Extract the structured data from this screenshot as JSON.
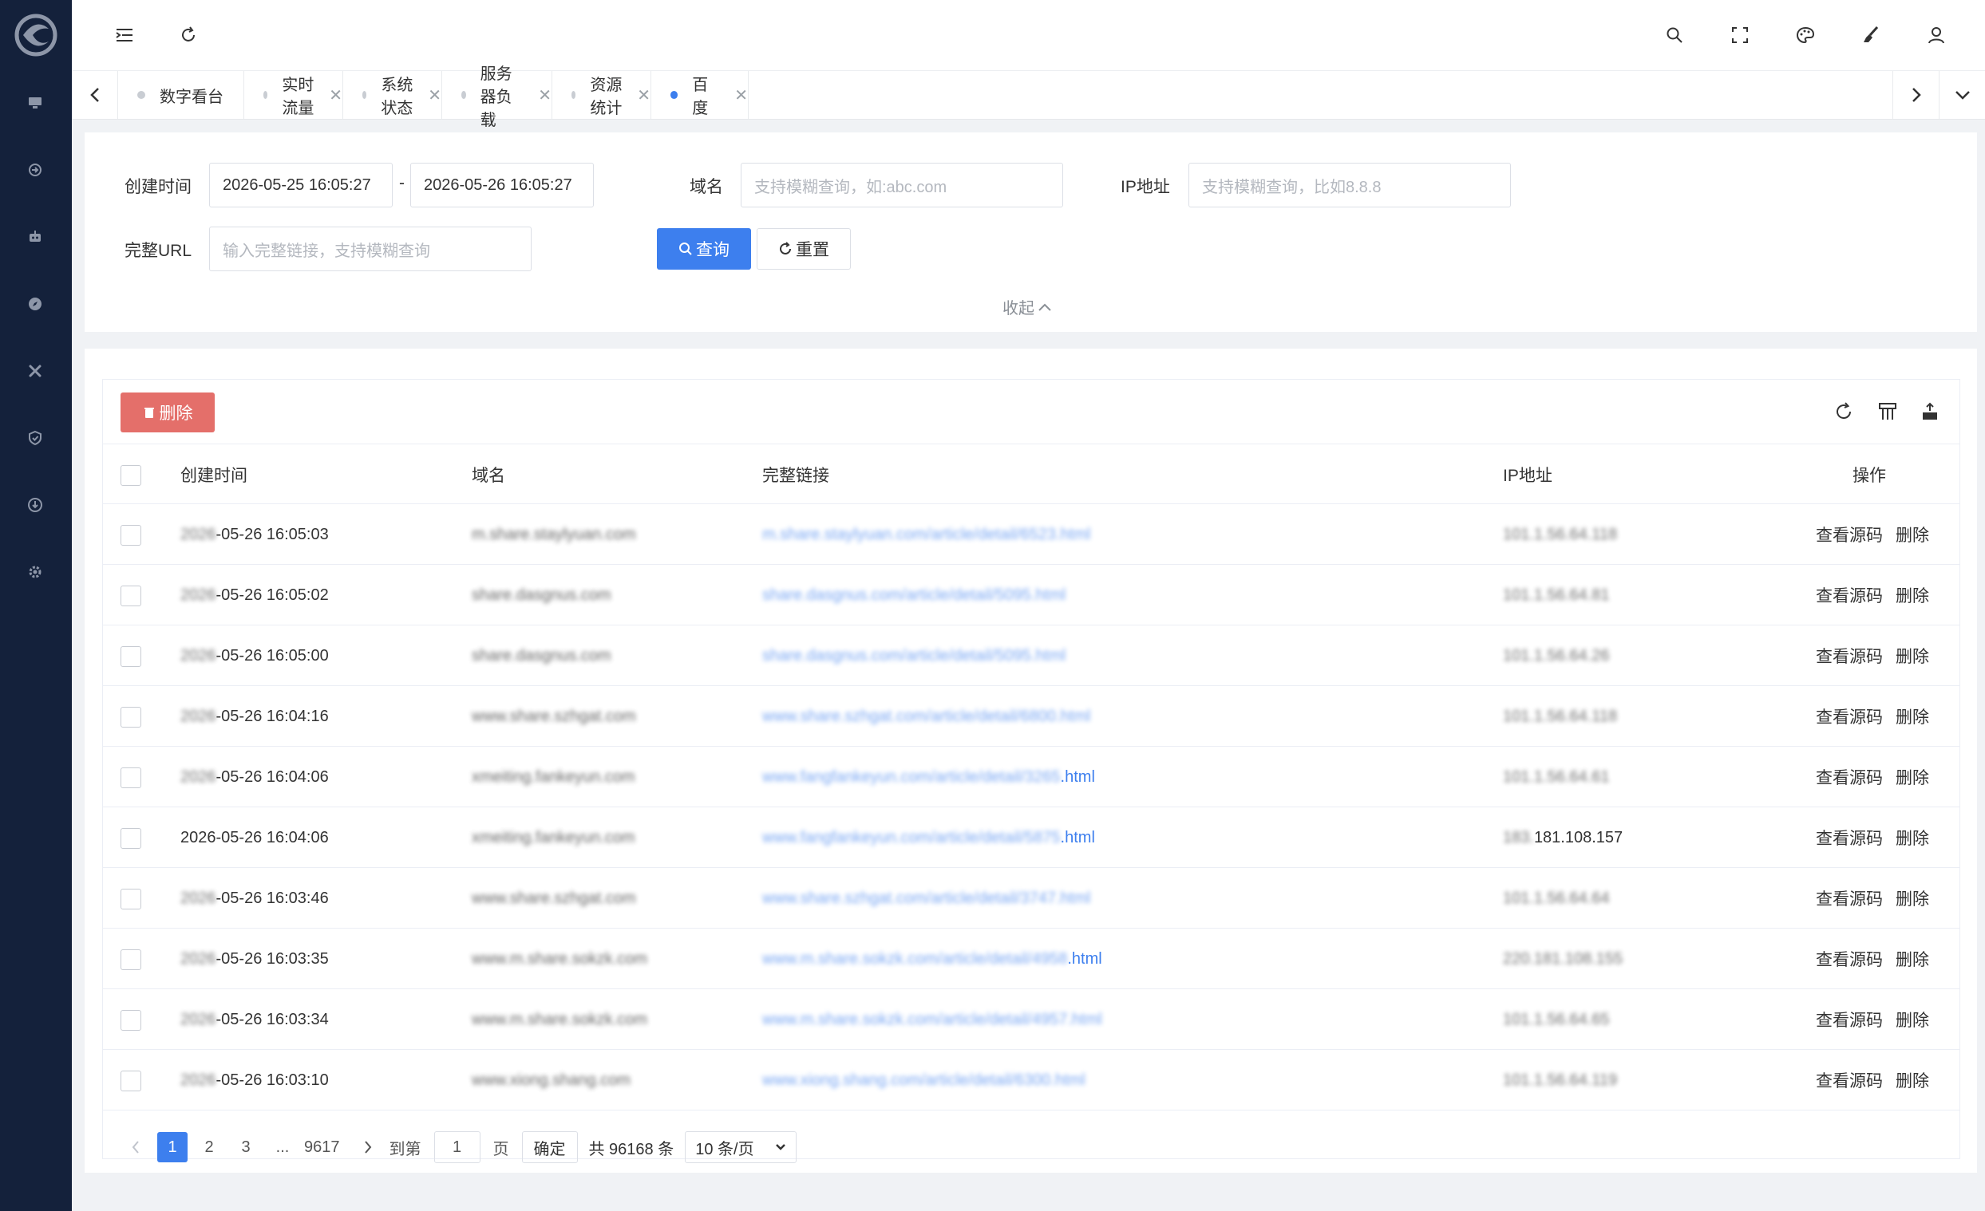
{
  "sidebar": {
    "icons": [
      "logo-icon",
      "monitor-icon",
      "traffic-icon",
      "robot-icon",
      "compass-icon",
      "tools-icon",
      "shield-icon",
      "download-icon",
      "gear-icon"
    ]
  },
  "tabs": [
    {
      "label": "数字看台",
      "active": false,
      "closable": false
    },
    {
      "label": "实时流量",
      "active": false,
      "closable": true
    },
    {
      "label": "系统状态",
      "active": false,
      "closable": true
    },
    {
      "label": "服务器负载",
      "active": false,
      "closable": true
    },
    {
      "label": "资源统计",
      "active": false,
      "closable": true
    },
    {
      "label": "百度",
      "active": true,
      "closable": true
    }
  ],
  "filters": {
    "created_label": "创建时间",
    "start_date": "2026-05-25 16:05:27",
    "range_sep": "-",
    "end_date": "2026-05-26 16:05:27",
    "domain_label": "域名",
    "domain_placeholder": "支持模糊查询，如:abc.com",
    "ip_label": "IP地址",
    "ip_placeholder": "支持模糊查询，比如8.8.8",
    "url_label": "完整URL",
    "url_placeholder": "输入完整链接，支持模糊查询",
    "search_label": "查询",
    "reset_label": "重置",
    "collapse_label": "收起"
  },
  "toolbar": {
    "delete_label": "删除"
  },
  "table": {
    "columns": [
      "创建时间",
      "域名",
      "完整链接",
      "IP地址",
      "操作"
    ],
    "rows": [
      {
        "time_prefix": "2026",
        "time": "-05-26 16:05:03",
        "domain": "m.share.staylyuan.com",
        "url": "m.share.staylyuan.com/article/detail/6523.html",
        "ip": "101.1.56.64.118"
      },
      {
        "time_prefix": "2026",
        "time": "-05-26 16:05:02",
        "domain": "share.dasgnus.com",
        "url": "share.dasgnus.com/article/detail/5095.html",
        "ip": "101.1.56.64.81"
      },
      {
        "time_prefix": "2026",
        "time": "-05-26 16:05:00",
        "domain": "share.dasgnus.com",
        "url": "share.dasgnus.com/article/detail/5095.html",
        "ip": "101.1.56.64.26"
      },
      {
        "time_prefix": "2026",
        "time": "-05-26 16:04:16",
        "domain": "www.share.szhgat.com",
        "url": "www.share.szhgat.com/article/detail/6800.html",
        "ip": "101.1.56.64.118"
      },
      {
        "time_prefix": "2026",
        "time": "-05-26 16:04:06",
        "domain": "xmeiting.fankeyun.com",
        "url": "www.fangfankeyun.com/article/detail/3265",
        "url_suffix": ".html",
        "ip": "101.1.56.64.61"
      },
      {
        "time_prefix": "",
        "time": "2026-05-26 16:04:06",
        "domain": "xmeiting.fankeyun.com",
        "url": "www.fangfankeyun.com/article/detail/5875",
        "url_suffix": ".html",
        "ip_prefix": "183.",
        "ip": "181.108.157"
      },
      {
        "time_prefix": "2026",
        "time": "-05-26 16:03:46",
        "domain": "www.share.szhgat.com",
        "url": "www.share.szhgat.com/article/detail/3747.html",
        "ip": "101.1.56.64.64"
      },
      {
        "time_prefix": "2026",
        "time": "-05-26 16:03:35",
        "domain": "www.m.share.sokzk.com",
        "url": "www.m.share.sokzk.com/article/detail/4958",
        "url_suffix": ".html",
        "ip": "220.181.108.155"
      },
      {
        "time_prefix": "2026",
        "time": "-05-26 16:03:34",
        "domain": "www.m.share.sokzk.com",
        "url": "www.m.share.sokzk.com/article/detail/4957.html",
        "ip": "101.1.56.64.65"
      },
      {
        "time_prefix": "2026",
        "time": "-05-26 16:03:10",
        "domain": "www.xiong.shang.com",
        "url": "www.xiong.shang.com/article/detail/6300.html",
        "ip": "101.1.56.64.119"
      }
    ],
    "ops": {
      "view_source": "查看源码",
      "delete": "删除"
    }
  },
  "pagination": {
    "pages": [
      "1",
      "2",
      "3"
    ],
    "ellipsis": "...",
    "last_page": "9617",
    "goto_label": "到第",
    "goto_value": "1",
    "page_unit": "页",
    "confirm_label": "确定",
    "total_label": "共 96168 条",
    "page_size": "10 条/页"
  }
}
